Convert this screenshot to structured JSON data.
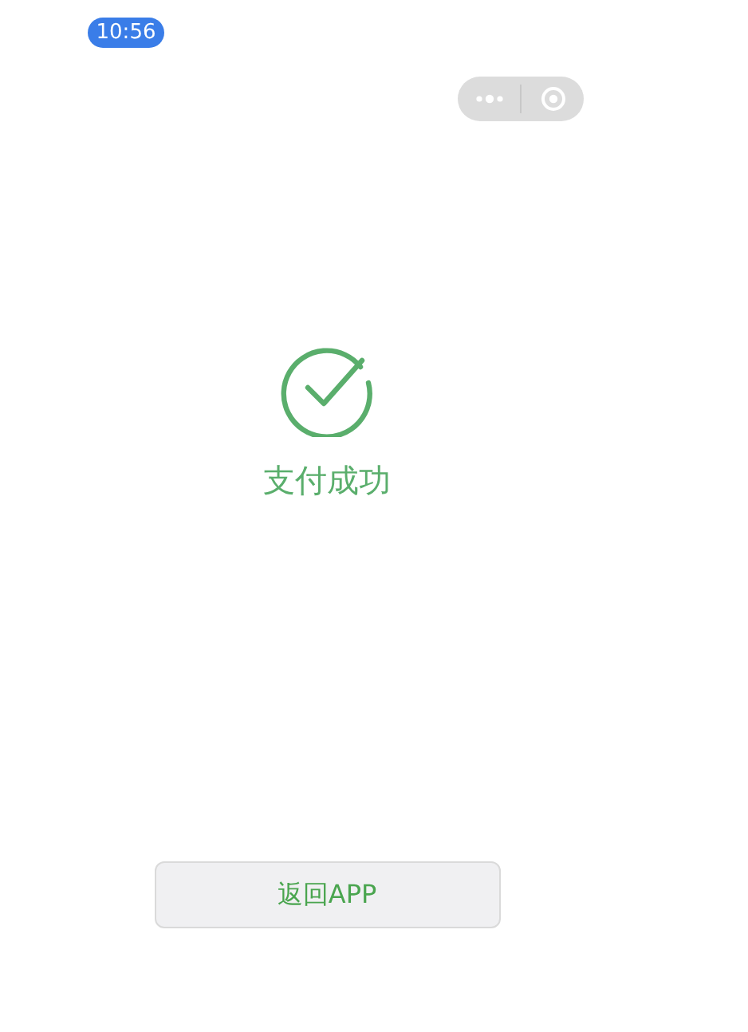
{
  "status_bar": {
    "time": "10:56"
  },
  "result": {
    "title": "支付成功"
  },
  "buttons": [
    {
      "label": "返回APP"
    }
  ]
}
